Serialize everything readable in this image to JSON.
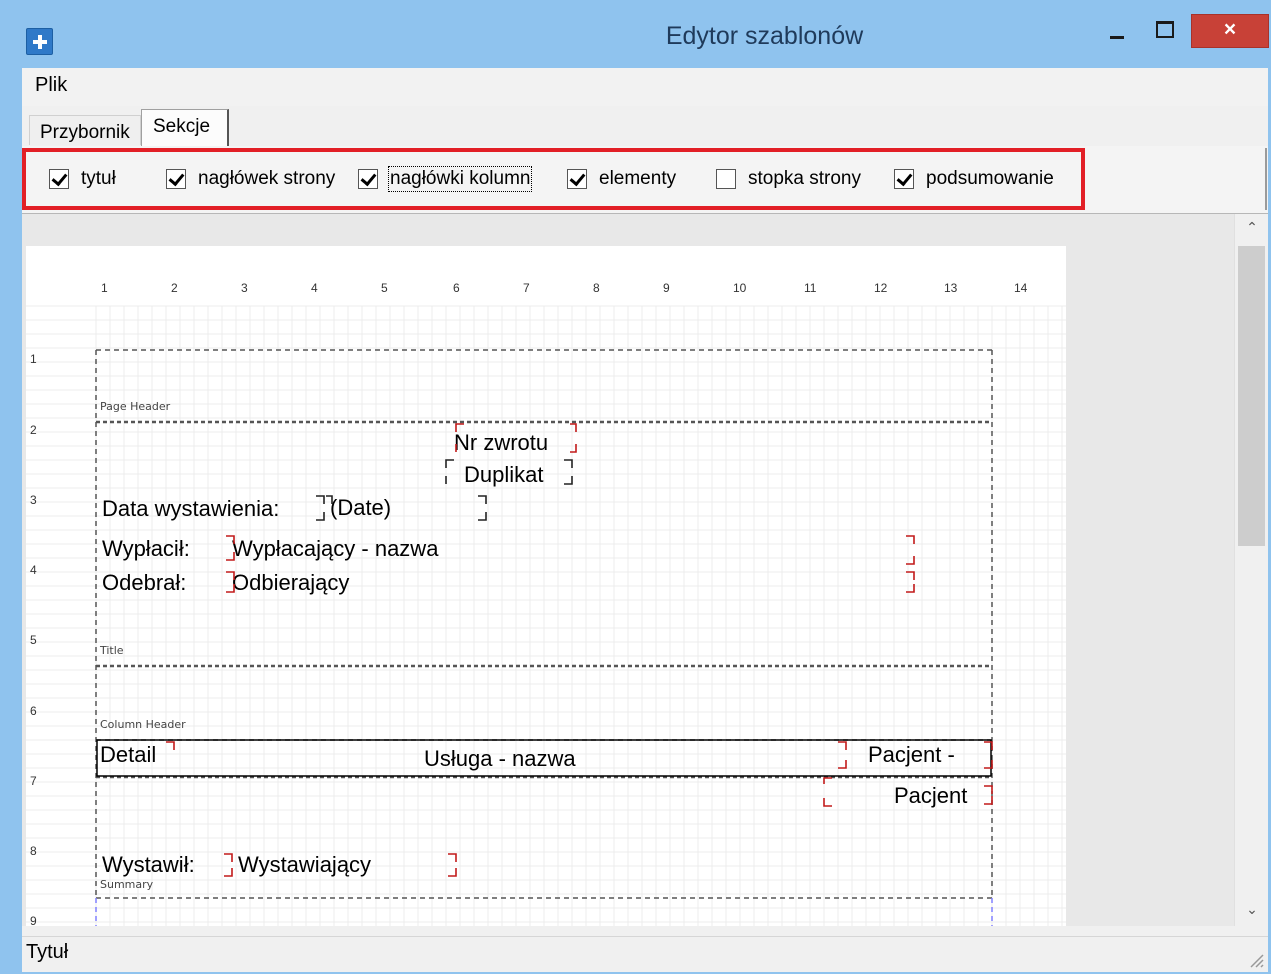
{
  "window": {
    "title": "Edytor szablonów",
    "close_glyph": "×",
    "accent": "#8fc3ee",
    "close_color": "#c84137"
  },
  "menu": {
    "items": [
      "Plik"
    ]
  },
  "tabs": [
    {
      "label": "Przybornik",
      "selected": false
    },
    {
      "label": "Sekcje",
      "selected": true
    }
  ],
  "sections": [
    {
      "label": "tytuł",
      "checked": true
    },
    {
      "label": "nagłówek strony",
      "checked": true
    },
    {
      "label": "nagłówki kolumn",
      "checked": true
    },
    {
      "label": "elementy",
      "checked": true
    },
    {
      "label": "stopka strony",
      "checked": false
    },
    {
      "label": "podsumowanie",
      "checked": true
    }
  ],
  "highlight_color": "#e21f26",
  "ruler": {
    "columns": [
      "1",
      "2",
      "3",
      "4",
      "5",
      "6",
      "7",
      "8",
      "9",
      "10",
      "11",
      "12",
      "13",
      "14"
    ],
    "rows": [
      "1",
      "2",
      "3",
      "4",
      "5",
      "6",
      "7",
      "8",
      "9"
    ]
  },
  "report": {
    "band_labels": {
      "page_header": "Page Header",
      "title": "Title",
      "column_header": "Column Header",
      "summary": "Summary"
    },
    "fields": {
      "nr_zwrotu": "Nr zwrotu",
      "duplikat": "Duplikat",
      "data_wystawienia": "Data wystawienia:",
      "date": "(Date)",
      "wyplacil": "Wypłacił:",
      "wyplacajacy": "Wypłacający - nazwa",
      "odebral": "Odebrał:",
      "odbierajacy": "Odbierający",
      "detail": "Detail",
      "usluga": "Usługa - nazwa",
      "pacjent_dash": "Pacjent -",
      "pacjent": "Pacjent",
      "wystawil": "Wystawił:",
      "wystawiajacy": "Wystawiający"
    }
  },
  "scrollbar": {
    "up_icon": "chevron-up",
    "down_icon": "chevron-down",
    "up_glyph": "⌃",
    "down_glyph": "⌄"
  },
  "status": {
    "text": "Tytuł"
  }
}
